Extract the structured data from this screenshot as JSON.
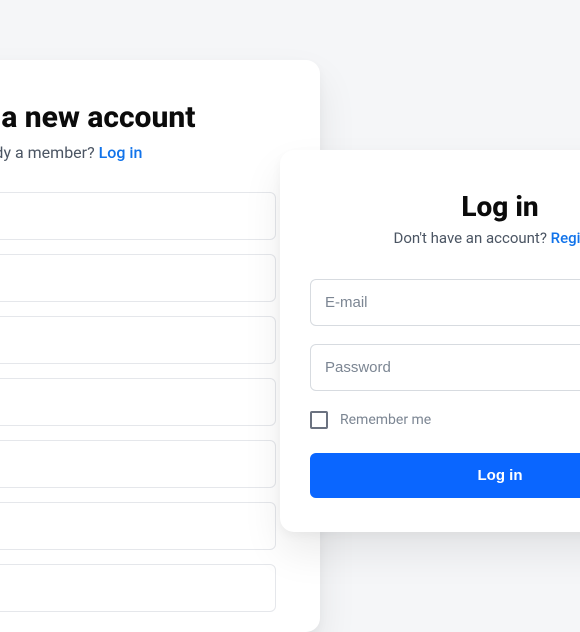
{
  "register": {
    "title": "Create a new account",
    "sub_text": "Already a member? ",
    "sub_link": "Log in"
  },
  "login": {
    "title": "Log in",
    "sub_text": "Don't have an account? ",
    "sub_link": "Register",
    "email_placeholder": "E-mail",
    "password_placeholder": "Password",
    "remember_label": "Remember me",
    "submit_label": "Log in"
  },
  "colors": {
    "accent": "#0a66ff",
    "link": "#1173ea"
  }
}
